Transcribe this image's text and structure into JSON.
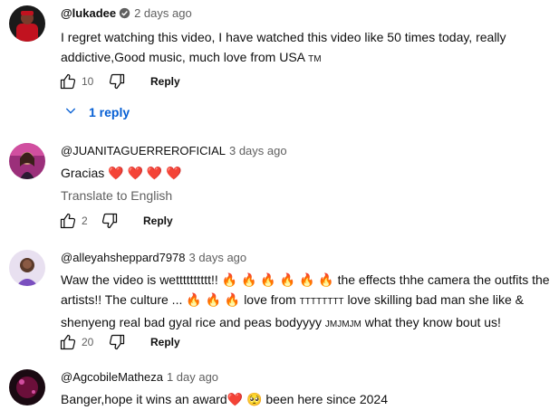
{
  "comments": [
    {
      "author": "@lukadee",
      "verified": true,
      "time": "2 days ago",
      "text": "I regret watching this video, I have watched this video like 50 times today, really addictive,Good music, much love from USA",
      "text_suffix": "TM",
      "likes": "10",
      "reply_label": "Reply",
      "replies_label": "1 reply",
      "avatar_color": "#c1121f"
    },
    {
      "author": "@JUANITAGUERREROFICIAL",
      "time": "3 days ago",
      "text": "Gracias ❤️ ❤️ ❤️ ❤️",
      "translate_label": "Translate to English",
      "likes": "2",
      "reply_label": "Reply",
      "avatar_color": "#9b2f7a"
    },
    {
      "author": "@alleyahsheppard7978",
      "time": "3 days ago",
      "text_part1": "Waw the video is wetttttttttt!! 🔥 🔥 🔥 🔥 🔥 🔥 the effects thhe camera the outfits the artists!! The culture ... 🔥 🔥 🔥 love from",
      "text_small1": "TTTTTTTT",
      "text_part2": "love skilling bad man she like & shenyeng real bad gyal rice and peas bodyyyy",
      "text_small2": "JMJMJM",
      "text_part3": "what they know bout us!",
      "likes": "20",
      "reply_label": "Reply",
      "avatar_color": "#7a4fbf"
    },
    {
      "author": "@AgcobileMatheza",
      "time": "1 day ago",
      "text": "Banger,hope it wins an award❤️ 🥺 been here since 2024",
      "avatar_color": "#6b0f3a"
    }
  ],
  "icons": {
    "like": "thumbs-up-icon",
    "dislike": "thumbs-down-icon",
    "verified": "verified-badge-icon",
    "expand": "chevron-down-icon"
  },
  "colors": {
    "link_blue": "#065fd4",
    "secondary_text": "#606060",
    "primary_text": "#0f0f0f"
  }
}
